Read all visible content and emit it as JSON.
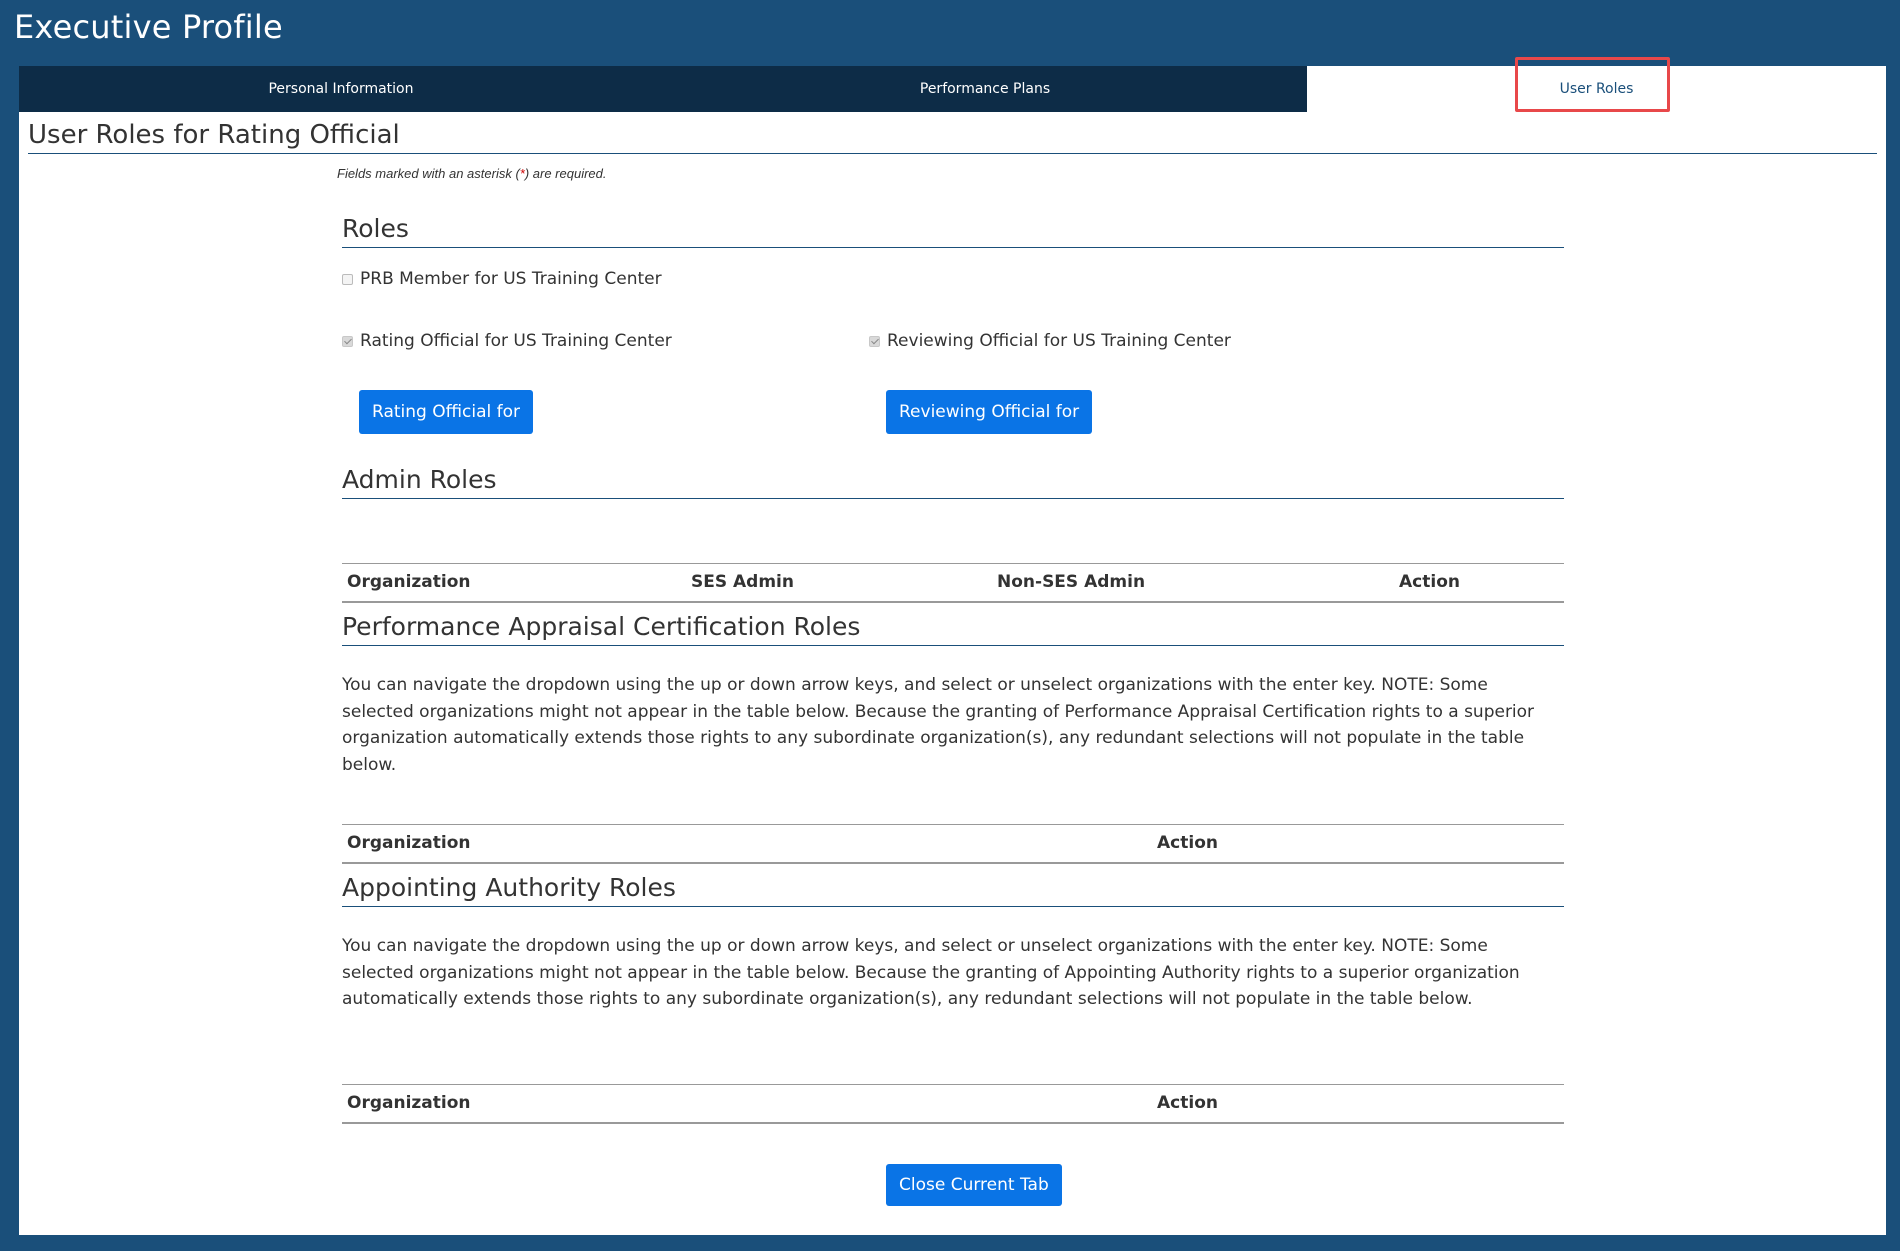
{
  "window": {
    "title": "Executive Profile"
  },
  "tabs": [
    {
      "label": "Personal Information"
    },
    {
      "label": "Performance Plans"
    },
    {
      "label": "User Roles"
    }
  ],
  "page": {
    "title": "User Roles for Rating Official",
    "required_note_prefix": "Fields marked with an asterisk (",
    "required_note_asterisk": "*",
    "required_note_suffix": ") are required."
  },
  "roles": {
    "heading": "Roles",
    "prb_member": {
      "label": "PRB Member for US Training Center",
      "checked": false
    },
    "rating_official": {
      "label": "Rating Official for US Training Center",
      "checked": true
    },
    "reviewing_official": {
      "label": "Reviewing Official for US Training Center",
      "checked": true
    },
    "rating_button": "Rating Official for",
    "reviewing_button": "Reviewing Official for"
  },
  "admin_roles": {
    "heading": "Admin Roles",
    "columns": [
      "Organization",
      "SES Admin",
      "Non-SES Admin",
      "Action"
    ]
  },
  "pac_roles": {
    "heading": "Performance Appraisal Certification Roles",
    "description": "You can navigate the dropdown using the up or down arrow keys, and select or unselect organizations with the enter key. NOTE: Some selected organizations might not appear in the table below. Because the granting of Performance Appraisal Certification rights to a superior organization automatically extends those rights to any subordinate organization(s), any redundant selections will not populate in the table below.",
    "columns": [
      "Organization",
      "Action"
    ]
  },
  "aa_roles": {
    "heading": "Appointing Authority Roles",
    "description": "You can navigate the dropdown using the up or down arrow keys, and select or unselect organizations with the enter key. NOTE: Some selected organizations might not appear in the table below. Because the granting of Appointing Authority rights to a superior organization automatically extends those rights to any subordinate organization(s), any redundant selections will not populate in the table below.",
    "columns": [
      "Organization",
      "Action"
    ]
  },
  "footer": {
    "close_button": "Close Current Tab"
  },
  "colors": {
    "brand": "#1a4f7a",
    "tabbar": "#0d2c47",
    "button": "#0a74e6",
    "highlight": "#e8484a"
  }
}
